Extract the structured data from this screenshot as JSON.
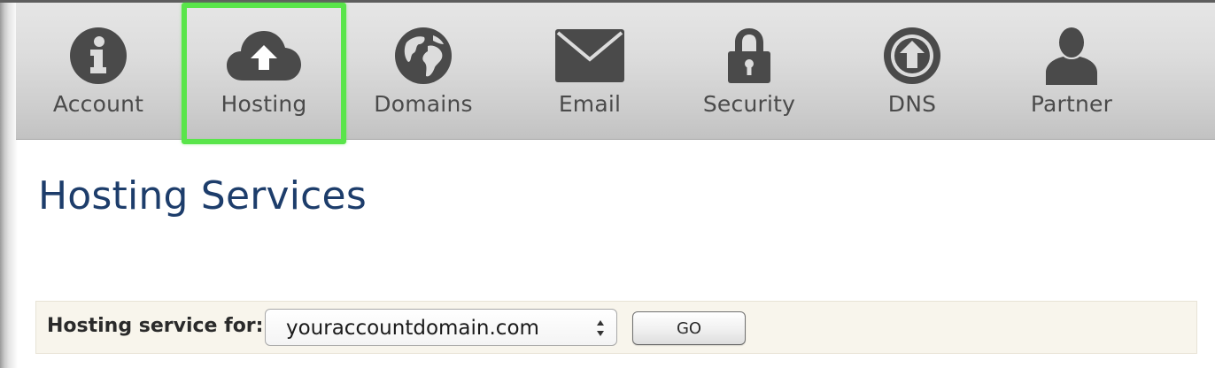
{
  "nav": {
    "items": [
      {
        "label": "Account",
        "icon": "info-icon"
      },
      {
        "label": "Hosting",
        "icon": "cloud-upload-icon",
        "highlighted": true
      },
      {
        "label": "Domains",
        "icon": "globe-icon"
      },
      {
        "label": "Email",
        "icon": "envelope-icon"
      },
      {
        "label": "Security",
        "icon": "lock-icon"
      },
      {
        "label": "DNS",
        "icon": "upload-circle-icon"
      },
      {
        "label": "Partner",
        "icon": "user-icon"
      }
    ]
  },
  "page": {
    "title": "Hosting Services"
  },
  "service": {
    "label": "Hosting service for:",
    "selected_domain": "youraccountdomain.com",
    "go_label": "GO"
  },
  "colors": {
    "highlight": "#59e54a",
    "title": "#1d3d6b",
    "icon": "#4a4a4a"
  }
}
